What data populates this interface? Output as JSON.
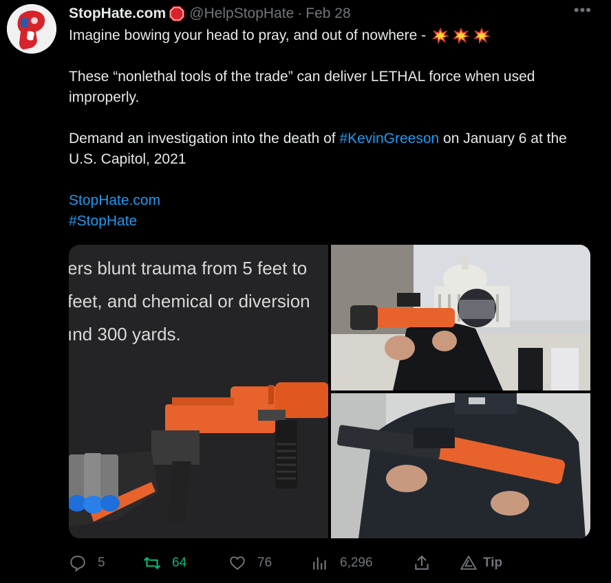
{
  "author": {
    "name": "StopHate.com",
    "handle": "@HelpStopHate",
    "separator": "·",
    "date": "Feb 28",
    "avatar_icon": "fist-icon"
  },
  "more_label": "•••",
  "tweet": {
    "line1": "Imagine bowing your head to pray, and out of nowhere -",
    "para2": "These “nonlethal tools of the trade” can deliver LETHAL force when used improperly.",
    "para3_start": "Demand an investigation into the death of ",
    "hashtag1": "#KevinGreeson",
    "para3_end": " on January 6 at the U.S. Capitol, 2021",
    "link": "StopHate.com",
    "hashtag2": "#StopHate"
  },
  "media": {
    "left_text": [
      "ers blunt trauma from 5 feet to",
      "feet, and chemical or diversion",
      "ınd 300 yards."
    ]
  },
  "actions": {
    "replies": "5",
    "retweets": "64",
    "likes": "76",
    "views": "6,296",
    "tip": "Tip"
  },
  "colors": {
    "link": "#1d9bf0",
    "retweet": "#00ba7c",
    "muted": "#71767b",
    "launcher_orange": "#e8622c"
  }
}
